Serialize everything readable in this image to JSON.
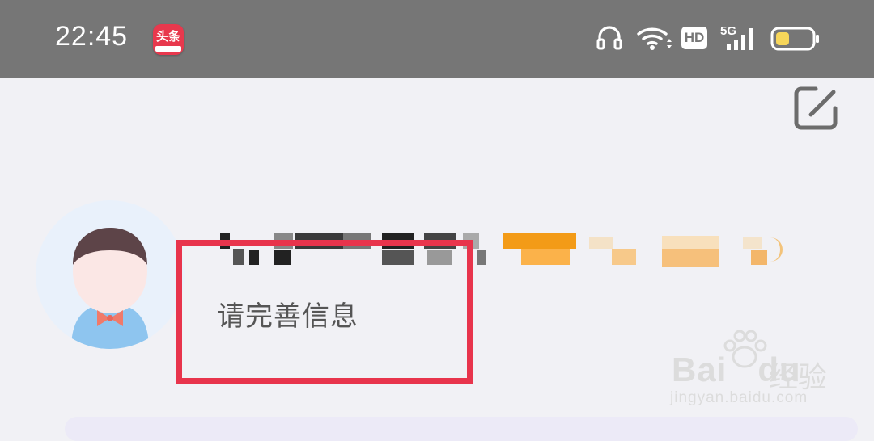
{
  "status_bar": {
    "time": "22:45",
    "app_icon": "toutiao-app-icon",
    "app_icon_label": "头条",
    "icons": [
      "headset-icon",
      "wifi-icon",
      "hd-icon",
      "signal-5g-icon",
      "battery-icon"
    ],
    "hd_label": "HD",
    "network_label": "5G",
    "battery_color": "#f7d65a"
  },
  "header": {
    "edit_icon": "edit-icon"
  },
  "profile": {
    "avatar_icon": "default-avatar-icon",
    "username_obscured": "pixelated username",
    "prompt": "请完善信息",
    "highlight_color": "#e8344c"
  },
  "watermark": {
    "brand": "Bai",
    "brand_suffix": "du",
    "cn": "经验",
    "url": "jingyan.baidu.com"
  }
}
